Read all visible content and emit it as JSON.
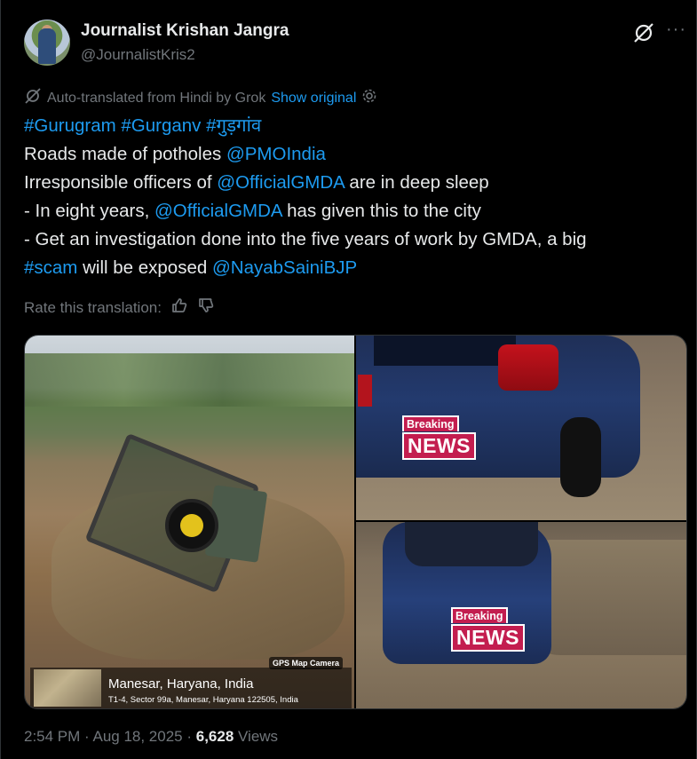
{
  "author": {
    "name": "Journalist Krishan Jangra",
    "handle": "@JournalistKris2"
  },
  "header_icons": {
    "grok": "grok-slash-icon",
    "more": "···"
  },
  "translation_bar": {
    "text": "Auto-translated from Hindi by Grok",
    "show_original": "Show original"
  },
  "tweet": {
    "hashtags_line": [
      "#Gurugram",
      "#Gurganv",
      "#गुड़गांव"
    ],
    "line2_text": "Roads made of potholes ",
    "line2_mention": "@PMOIndia",
    "line3_pre": "Irresponsible officers of ",
    "line3_mention": "@OfficialGMDA",
    "line3_post": " are in deep sleep",
    "line4_pre": "- In eight years, ",
    "line4_mention": "@OfficialGMDA",
    "line4_post": " has given this to the city",
    "line5_text": "- Get an investigation done into the five years of work by GMDA, a big",
    "line6_hashtag": "#scam",
    "line6_mid": " will be exposed ",
    "line6_mention": "@NayabSainiBJP"
  },
  "rate_translation": {
    "label": "Rate this translation:"
  },
  "media": {
    "gps_badge": "GPS Map Camera",
    "gps_title": "Manesar, Haryana, India",
    "gps_address": "T1-4, Sector 99a, Manesar, Haryana 122505, India",
    "overlay_breaking": "Breaking",
    "overlay_news": "NEWS"
  },
  "meta": {
    "time": "2:54 PM · Aug 18, 2025 · ",
    "views_count": "6,628",
    "views_label": " Views"
  }
}
